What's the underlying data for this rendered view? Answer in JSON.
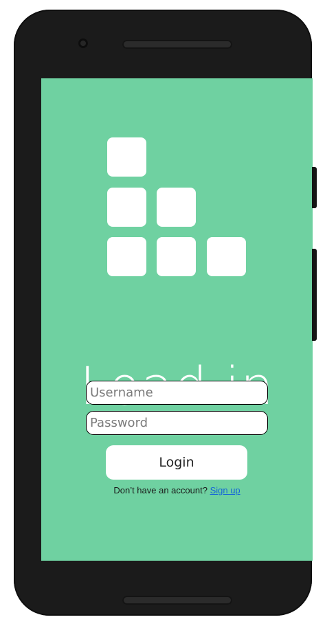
{
  "colors": {
    "screen_background": "#6fd1a1",
    "phone_frame": "#1b1b1b",
    "link": "#1565d8"
  },
  "logo": {
    "icon": "stacked-blocks-logo",
    "brand_name": "Load.in"
  },
  "login_form": {
    "username_placeholder": "Username",
    "password_placeholder": "Password",
    "login_label": "Login"
  },
  "signup": {
    "prompt": "Don’t have an account?",
    "link_label": "Sign up"
  }
}
